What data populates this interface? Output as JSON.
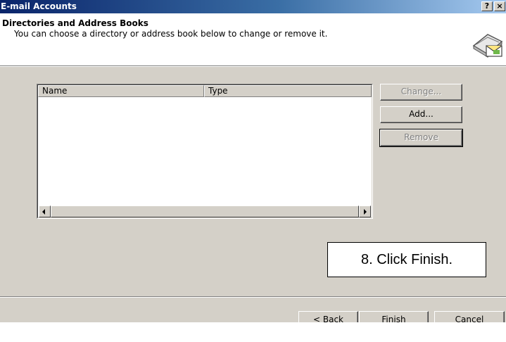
{
  "window": {
    "title": "E-mail Accounts",
    "help_button": "?",
    "close_button": "×"
  },
  "header": {
    "title": "Directories and Address Books",
    "subtitle": "You can choose a directory or address book below to change or remove it.",
    "icon": "address-book-envelope-icon"
  },
  "list": {
    "columns": [
      "Name",
      "Type"
    ],
    "rows": []
  },
  "side_buttons": {
    "change": "Change...",
    "add": "Add...",
    "remove": "Remove"
  },
  "callout": "8.  Click Finish.",
  "footer": {
    "back": "< Back",
    "finish": "Finish",
    "cancel": "Cancel"
  },
  "colors": {
    "titlebar_start": "#0a246a",
    "titlebar_end": "#a6caf0",
    "face": "#d4d0c8"
  }
}
